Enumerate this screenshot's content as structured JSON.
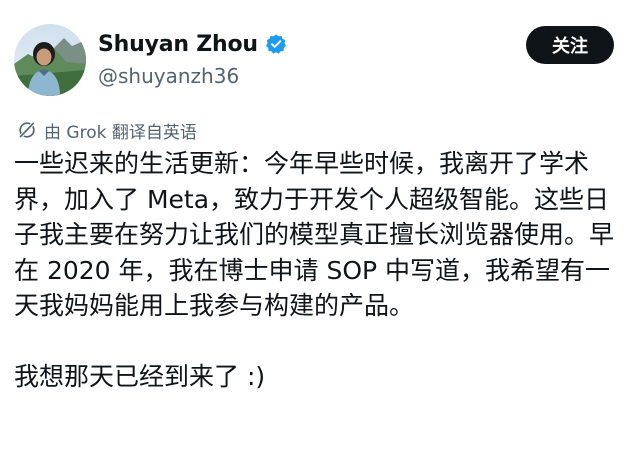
{
  "author": {
    "display_name": "Shuyan Zhou",
    "handle": "@shuyanzh36",
    "verified_badge_icon": "verified-check-icon",
    "verified_color": "#1d9bf0"
  },
  "follow_button": {
    "label": "关注"
  },
  "translation_note": {
    "icon": "grok-icon",
    "text": "由 Grok 翻译自英语"
  },
  "post": {
    "text": "一些迟来的生活更新：今年早些时候，我离开了学术界，加入了 Meta，致力于开发个人超级智能。这些日子我主要在努力让我们的模型真正擅长浏览器使用。早在 2020 年，我在博士申请 SOP 中写道，我希望有一天我妈妈能用上我参与构建的产品。\n\n我想那天已经到来了 :)"
  },
  "colors": {
    "text_primary": "#0f1419",
    "text_secondary": "#536471",
    "button_bg": "#0f1419"
  }
}
